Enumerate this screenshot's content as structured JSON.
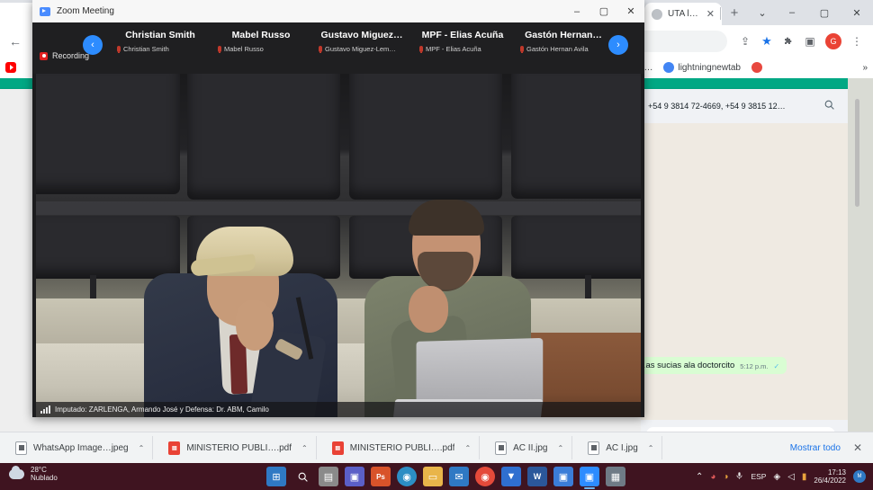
{
  "browser": {
    "tabs": [
      {
        "title": "",
        "favicon_color": "#25d366",
        "icon": "whatsapp-icon"
      },
      {
        "title": "",
        "favicon_color": "#00a884",
        "icon": "whatsapp-icon"
      },
      {
        "title": "UTA levanta el p…",
        "favicon_color": "#bdc1c6",
        "icon": "page-icon"
      }
    ],
    "new_tab_label": "+",
    "window_controls": {
      "chevron": "⌄",
      "minimize": "–",
      "maximize": "▢",
      "close": "✕"
    },
    "toolbar": {
      "back": "←",
      "forward": "→",
      "reload": "⟳",
      "share_icon": "⇪",
      "star_icon": "★",
      "extensions_icon": "🧩",
      "sidepanel_icon": "▣",
      "profile_initial": "G",
      "menu_icon": "⋮"
    },
    "bookmarks": [
      {
        "label": "",
        "icon": "youtube-icon"
      },
      {
        "label": "",
        "icon": "youtube-icon"
      },
      {
        "label": "…e Administr…",
        "icon": "page-icon"
      },
      {
        "label": "lightningnewtab",
        "icon": "globe-icon"
      },
      {
        "label": "",
        "icon": "red-dot-icon"
      }
    ],
    "bookmarks_overflow": "»"
  },
  "whatsapp": {
    "chat_header_title": "+54 9 3814 72-4669, +54 9 3815 12…",
    "search_icon": "🔍",
    "menu_icon": "⋮",
    "message": {
      "text": "…as sucias ala doctorcito",
      "time": "5:12 p.m.",
      "status_tick": "✓"
    },
    "input_placeholder": "",
    "mic_icon": "🎙"
  },
  "zoom": {
    "window_title": "Zoom Meeting",
    "window_controls": {
      "minimize": "–",
      "maximize": "▢",
      "close": "✕"
    },
    "nav_prev": "‹",
    "nav_next": "›",
    "participants": [
      {
        "name": "Christian Smith",
        "thumb_label": "Christian Smith"
      },
      {
        "name": "Mabel Russo",
        "thumb_label": "Mabel Russo"
      },
      {
        "name": "Gustavo  Miguez…",
        "thumb_label": "Gustavo Miguez-Lem…"
      },
      {
        "name": "MPF - Elias Acuña",
        "thumb_label": "MPF - Elias Acuña"
      },
      {
        "name": "Gastón  Hernan…",
        "thumb_label": "Gastón Hernan Avila"
      }
    ],
    "recording_label": "Recording",
    "caption": "Imputado: ZARLENGA, Armando José y Defensa: Dr. ABM, Camilo"
  },
  "download_shelf": {
    "items": [
      {
        "name": "WhatsApp Image…jpeg",
        "type": "image",
        "caret": "⌃"
      },
      {
        "name": "MINISTERIO PUBLI….pdf",
        "type": "pdf",
        "caret": "⌃"
      },
      {
        "name": "MINISTERIO PUBLI….pdf",
        "type": "pdf",
        "caret": "⌃"
      },
      {
        "name": "AC II.jpg",
        "type": "image",
        "caret": "⌃"
      },
      {
        "name": "AC I.jpg",
        "type": "image",
        "caret": "⌃"
      }
    ],
    "show_all_label": "Mostrar todo",
    "close_label": "✕"
  },
  "taskbar": {
    "weather": {
      "temperature": "28°C",
      "condition": "Nublado"
    },
    "apps": [
      {
        "name": "start-button",
        "glyph": "⊞",
        "color": "#2f79c4"
      },
      {
        "name": "search-button",
        "glyph": "🔍",
        "color": "transparent"
      },
      {
        "name": "task-view-button",
        "glyph": "▤",
        "color": "#8a8a8a"
      },
      {
        "name": "teams-button",
        "glyph": "▣",
        "color": "#5b5fc7"
      },
      {
        "name": "photoshop-button",
        "glyph": "Ps",
        "color": "#d8532a"
      },
      {
        "name": "edge-button",
        "glyph": "◉",
        "color": "#2c8ec4"
      },
      {
        "name": "file-explorer-button",
        "glyph": "▭",
        "color": "#e9b54a"
      },
      {
        "name": "mail-button",
        "glyph": "✉",
        "color": "#2f79c4"
      },
      {
        "name": "chrome-button",
        "glyph": "◉",
        "color": "#e44a3a"
      },
      {
        "name": "dropbox-button",
        "glyph": "▼",
        "color": "#2f6fd0"
      },
      {
        "name": "word-button",
        "glyph": "W",
        "color": "#2b579a"
      },
      {
        "name": "photos-button",
        "glyph": "▣",
        "color": "#3b7dd8"
      },
      {
        "name": "zoom-button",
        "glyph": "▣",
        "color": "#2d8cff"
      },
      {
        "name": "calculator-button",
        "glyph": "▦",
        "color": "#6f7b86"
      }
    ],
    "tray": {
      "overflow": "⌃",
      "icons": [
        "◕",
        "◑",
        "🎙"
      ],
      "language": "ESP",
      "wifi": "◈",
      "volume": "◁",
      "battery": "▮",
      "time": "17:13",
      "date": "26/4/2022",
      "avatar_initial": "M"
    }
  }
}
